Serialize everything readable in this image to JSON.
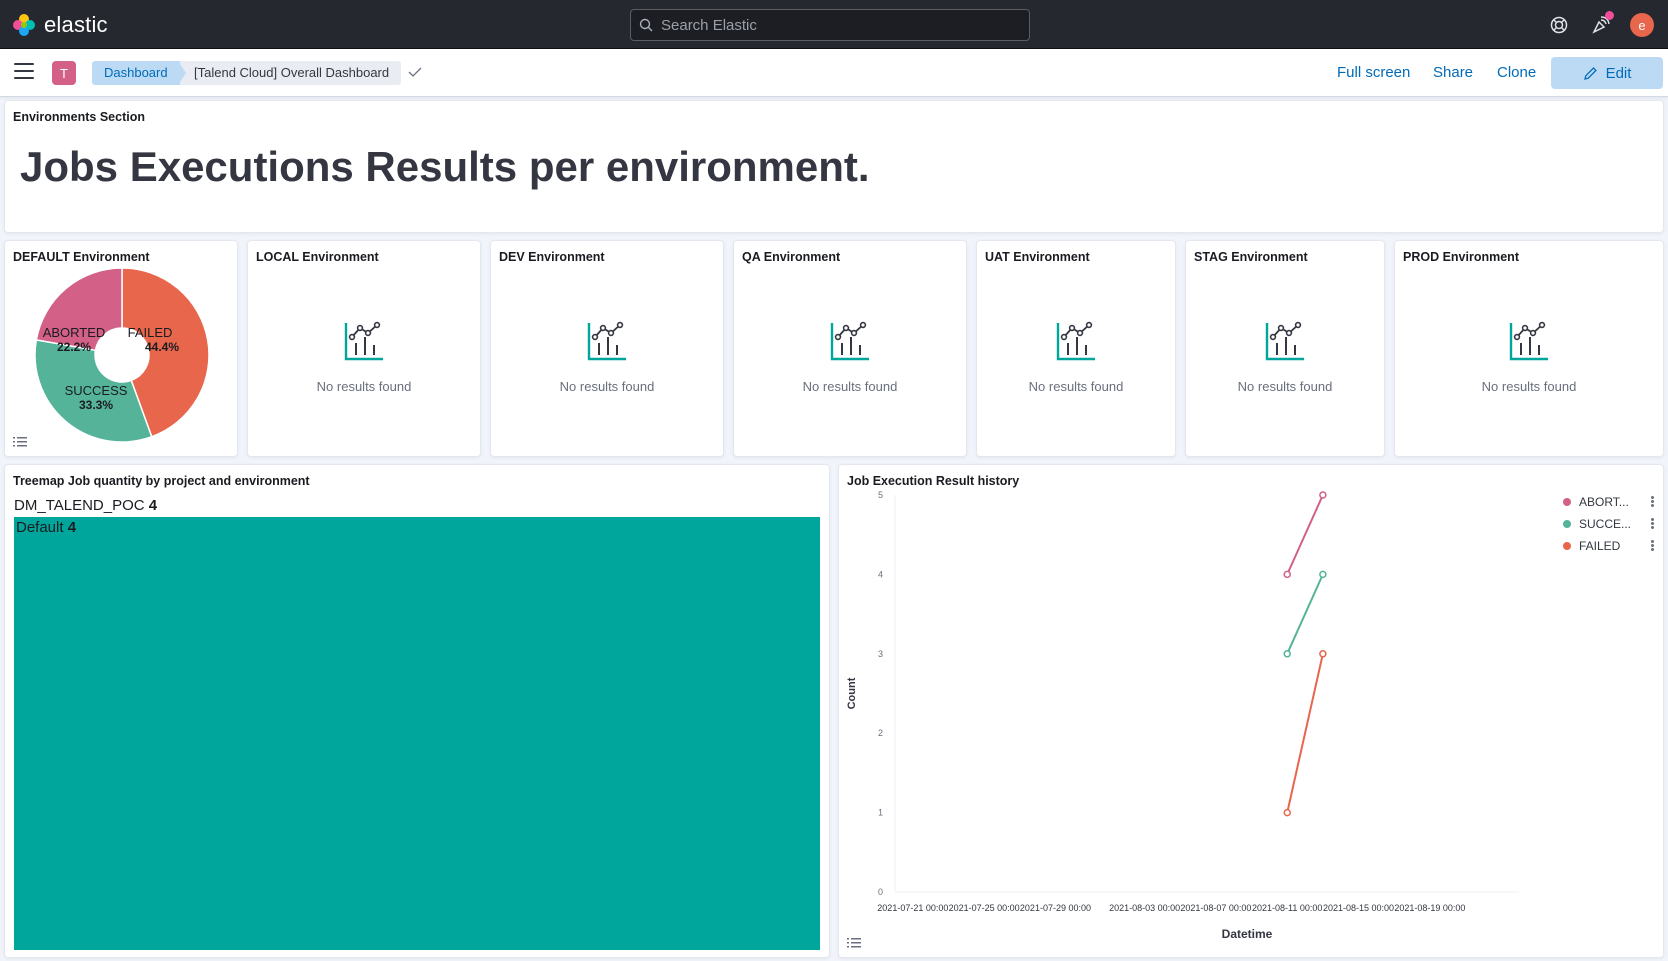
{
  "header": {
    "logo_text": "elastic",
    "search_placeholder": "Search Elastic",
    "avatar_initial": "e"
  },
  "subheader": {
    "space_initial": "T",
    "breadcrumbs": [
      "Dashboard",
      "[Talend Cloud] Overall Dashboard"
    ],
    "actions": {
      "fullscreen": "Full screen",
      "share": "Share",
      "clone": "Clone",
      "edit": "Edit"
    }
  },
  "markdown_panel": {
    "title": "Environments Section",
    "heading": "Jobs Executions Results per environment."
  },
  "default_panel": {
    "title": "DEFAULT Environment"
  },
  "env_panels": [
    {
      "title": "LOCAL Environment",
      "empty_text": "No results found"
    },
    {
      "title": "DEV Environment",
      "empty_text": "No results found"
    },
    {
      "title": "QA Environment",
      "empty_text": "No results found"
    },
    {
      "title": "UAT Environment",
      "empty_text": "No results found"
    },
    {
      "title": "STAG Environment",
      "empty_text": "No results found"
    },
    {
      "title": "PROD Environment",
      "empty_text": "No results found"
    }
  ],
  "treemap_panel": {
    "title": "Treemap Job quantity by project and environment",
    "project_label": "DM_TALEND_POC",
    "project_value": "4",
    "env_label": "Default",
    "env_value": "4",
    "color": "#00a69b"
  },
  "history_panel": {
    "title": "Job Execution Result history"
  },
  "chart_data": [
    {
      "type": "pie",
      "title": "DEFAULT Environment",
      "donut": true,
      "slices": [
        {
          "label": "FAILED",
          "value": 44.4,
          "display": "44.4%",
          "color": "#e7664c"
        },
        {
          "label": "SUCCESS",
          "value": 33.3,
          "display": "33.3%",
          "color": "#54b399"
        },
        {
          "label": "ABORTED",
          "value": 22.2,
          "display": "22.2%",
          "color": "#d36086"
        }
      ]
    },
    {
      "type": "line",
      "title": "Job Execution Result history",
      "xlabel": "Datetime",
      "ylabel": "Count",
      "ylim": [
        0,
        5
      ],
      "yticks": [
        "0",
        "1",
        "2",
        "3",
        "4",
        "5"
      ],
      "xticks": [
        "2021-07-21 00:00",
        "2021-07-25 00:00",
        "2021-07-29 00:00",
        "2021-08-03 00:00",
        "2021-08-07 00:00",
        "2021-08-11 00:00",
        "2021-08-15 00:00",
        "2021-08-19 00:00"
      ],
      "x": [
        "2021-08-11",
        "2021-08-13"
      ],
      "series": [
        {
          "name": "ABORT...",
          "color": "#d36086",
          "values": [
            4,
            5
          ]
        },
        {
          "name": "SUCCE...",
          "color": "#54b399",
          "values": [
            3,
            4
          ]
        },
        {
          "name": "FAILED",
          "color": "#e7664c",
          "values": [
            1,
            3
          ]
        }
      ],
      "legend": "top-right"
    }
  ]
}
